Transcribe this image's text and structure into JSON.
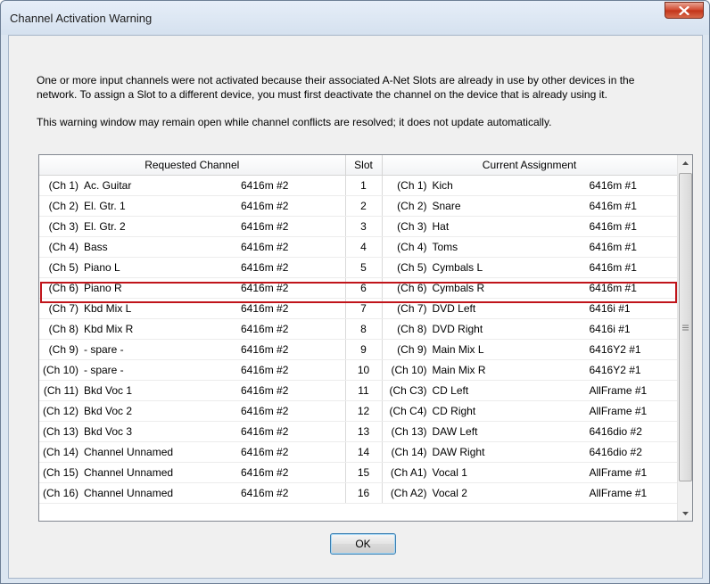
{
  "window": {
    "title": "Channel Activation Warning",
    "close_icon": "close-x-icon"
  },
  "message": {
    "line1": "One or more input channels were not activated because their associated A-Net Slots are already in use by other devices in the",
    "line2": "network. To assign a Slot to a different device, you must first deactivate the channel on the device that is already using it.",
    "line3": "This warning window may remain open while channel conflicts are resolved; it does not update automatically."
  },
  "table": {
    "headers": {
      "requested": "Requested Channel",
      "slot": "Slot",
      "current": "Current Assignment"
    },
    "highlight_color": "#c0141a",
    "rows": [
      {
        "req_ch": "(Ch 1)",
        "req_name": "Ac. Guitar",
        "req_dev": "6416m #2",
        "slot": "1",
        "cur_ch": "(Ch 1)",
        "cur_name": "Kich",
        "cur_dev": "6416m #1"
      },
      {
        "req_ch": "(Ch 2)",
        "req_name": "El. Gtr. 1",
        "req_dev": "6416m #2",
        "slot": "2",
        "cur_ch": "(Ch 2)",
        "cur_name": "Snare",
        "cur_dev": "6416m #1"
      },
      {
        "req_ch": "(Ch 3)",
        "req_name": "El. Gtr. 2",
        "req_dev": "6416m #2",
        "slot": "3",
        "cur_ch": "(Ch 3)",
        "cur_name": "Hat",
        "cur_dev": "6416m #1"
      },
      {
        "req_ch": "(Ch 4)",
        "req_name": "Bass",
        "req_dev": "6416m #2",
        "slot": "4",
        "cur_ch": "(Ch 4)",
        "cur_name": "Toms",
        "cur_dev": "6416m #1"
      },
      {
        "req_ch": "(Ch 5)",
        "req_name": "Piano L",
        "req_dev": "6416m #2",
        "slot": "5",
        "cur_ch": "(Ch 5)",
        "cur_name": "Cymbals L",
        "cur_dev": "6416m #1"
      },
      {
        "req_ch": "(Ch 6)",
        "req_name": "Piano R",
        "req_dev": "6416m #2",
        "slot": "6",
        "cur_ch": "(Ch 6)",
        "cur_name": "Cymbals R",
        "cur_dev": "6416m #1"
      },
      {
        "req_ch": "(Ch 7)",
        "req_name": "Kbd Mix L",
        "req_dev": "6416m #2",
        "slot": "7",
        "cur_ch": "(Ch 7)",
        "cur_name": "DVD Left",
        "cur_dev": "6416i #1"
      },
      {
        "req_ch": "(Ch 8)",
        "req_name": "Kbd Mix R",
        "req_dev": "6416m #2",
        "slot": "8",
        "cur_ch": "(Ch 8)",
        "cur_name": "DVD Right",
        "cur_dev": "6416i #1"
      },
      {
        "req_ch": "(Ch 9)",
        "req_name": "- spare -",
        "req_dev": "6416m #2",
        "slot": "9",
        "cur_ch": "(Ch 9)",
        "cur_name": "Main Mix L",
        "cur_dev": "6416Y2 #1"
      },
      {
        "req_ch": "(Ch 10)",
        "req_name": "- spare -",
        "req_dev": "6416m #2",
        "slot": "10",
        "cur_ch": "(Ch 10)",
        "cur_name": "Main Mix R",
        "cur_dev": "6416Y2 #1"
      },
      {
        "req_ch": "(Ch 11)",
        "req_name": "Bkd Voc 1",
        "req_dev": "6416m #2",
        "slot": "11",
        "cur_ch": "(Ch C3)",
        "cur_name": "CD Left",
        "cur_dev": "AllFrame #1"
      },
      {
        "req_ch": "(Ch 12)",
        "req_name": "Bkd Voc 2",
        "req_dev": "6416m #2",
        "slot": "12",
        "cur_ch": "(Ch C4)",
        "cur_name": "CD Right",
        "cur_dev": "AllFrame #1"
      },
      {
        "req_ch": "(Ch 13)",
        "req_name": "Bkd Voc 3",
        "req_dev": "6416m #2",
        "slot": "13",
        "cur_ch": "(Ch 13)",
        "cur_name": "DAW Left",
        "cur_dev": "6416dio #2"
      },
      {
        "req_ch": "(Ch 14)",
        "req_name": "Channel Unnamed",
        "req_dev": "6416m #2",
        "slot": "14",
        "cur_ch": "(Ch 14)",
        "cur_name": "DAW Right",
        "cur_dev": "6416dio #2"
      },
      {
        "req_ch": "(Ch 15)",
        "req_name": "Channel Unnamed",
        "req_dev": "6416m #2",
        "slot": "15",
        "cur_ch": "(Ch A1)",
        "cur_name": "Vocal 1",
        "cur_dev": "AllFrame #1"
      },
      {
        "req_ch": "(Ch 16)",
        "req_name": "Channel Unnamed",
        "req_dev": "6416m #2",
        "slot": "16",
        "cur_ch": "(Ch A2)",
        "cur_name": "Vocal 2",
        "cur_dev": "AllFrame #1"
      }
    ]
  },
  "scrollbar": {
    "up_icon": "chevron-up-icon",
    "down_icon": "chevron-down-icon",
    "grip_icon": "grip-icon"
  },
  "buttons": {
    "ok_label": "OK"
  }
}
